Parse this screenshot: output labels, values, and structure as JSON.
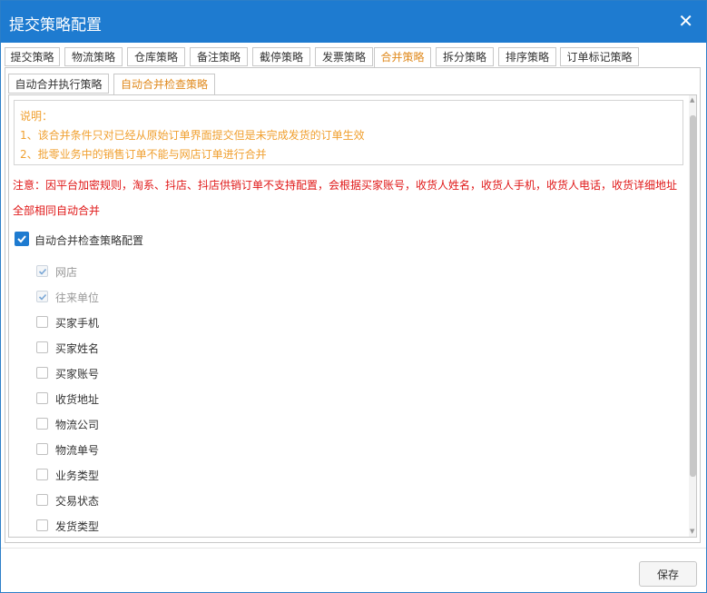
{
  "dialog": {
    "title": "提交策略配置",
    "close_symbol": "✕"
  },
  "tabs": [
    {
      "label": "提交策略",
      "active": false
    },
    {
      "label": "物流策略",
      "active": false
    },
    {
      "label": "仓库策略",
      "active": false
    },
    {
      "label": "备注策略",
      "active": false
    },
    {
      "label": "截停策略",
      "active": false
    },
    {
      "label": "发票策略",
      "active": false
    },
    {
      "label": "合并策略",
      "active": true
    },
    {
      "label": "拆分策略",
      "active": false
    },
    {
      "label": "排序策略",
      "active": false
    },
    {
      "label": "订单标记策略",
      "active": false
    }
  ],
  "subtabs": [
    {
      "label": "自动合并执行策略",
      "active": false
    },
    {
      "label": "自动合并检查策略",
      "active": true
    }
  ],
  "notes": {
    "heading": "说明：",
    "line1": "1、该合并条件只对已经从原始订单界面提交但是未完成发货的订单生效",
    "line2": "2、批零业务中的销售订单不能与网店订单进行合并"
  },
  "warning": {
    "line1": "注意：因平台加密规则，淘系、抖店、抖店供销订单不支持配置，会根据买家账号，收货人姓名，收货人手机，收货人电话，收货详细地址",
    "line2": "全部相同自动合并"
  },
  "main_option": {
    "label": "自动合并检查策略配置",
    "checked": true
  },
  "options": [
    {
      "label": "网店",
      "checked": true,
      "disabled": true
    },
    {
      "label": "往来单位",
      "checked": true,
      "disabled": true
    },
    {
      "label": "买家手机",
      "checked": false,
      "disabled": false
    },
    {
      "label": "买家姓名",
      "checked": false,
      "disabled": false
    },
    {
      "label": "买家账号",
      "checked": false,
      "disabled": false
    },
    {
      "label": "收货地址",
      "checked": false,
      "disabled": false
    },
    {
      "label": "物流公司",
      "checked": false,
      "disabled": false
    },
    {
      "label": "物流单号",
      "checked": false,
      "disabled": false
    },
    {
      "label": "业务类型",
      "checked": false,
      "disabled": false
    },
    {
      "label": "交易状态",
      "checked": false,
      "disabled": false
    },
    {
      "label": "发货类型",
      "checked": false,
      "disabled": false
    }
  ],
  "footer": {
    "save_label": "保存"
  },
  "colors": {
    "titlebar": "#1e7bd0",
    "active_tab": "#e08a1e",
    "note": "#f0a030",
    "warning": "#e01818"
  }
}
